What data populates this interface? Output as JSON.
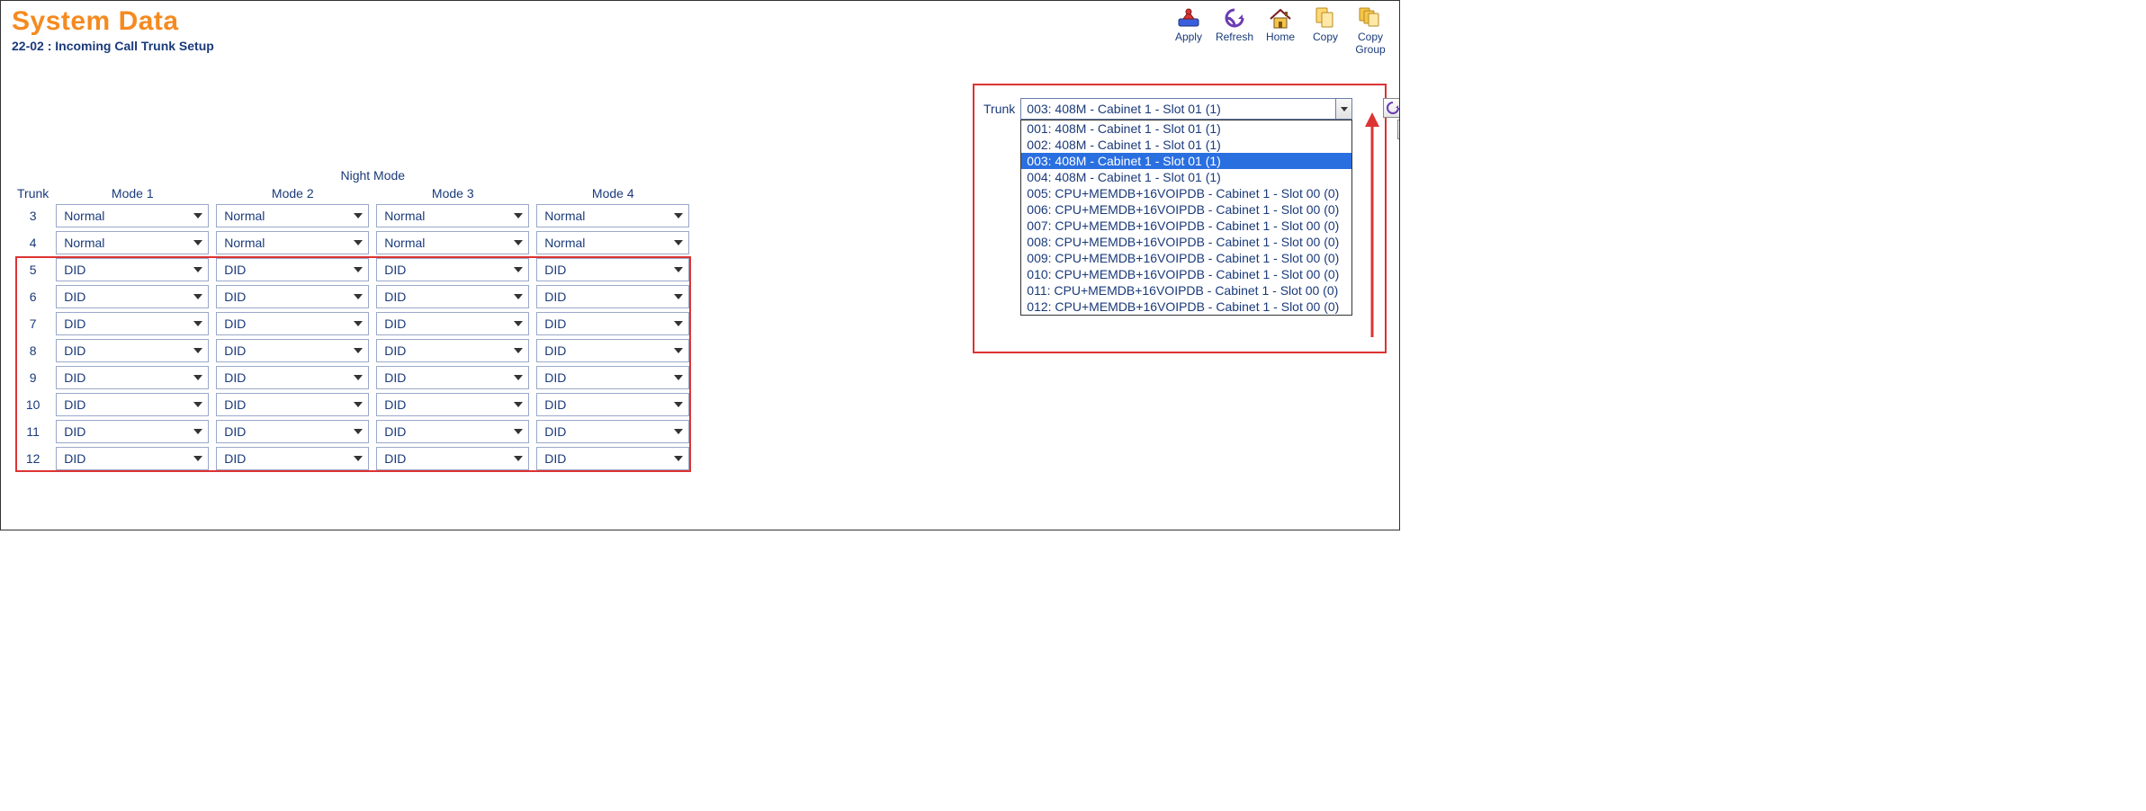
{
  "heading": {
    "title": "System Data",
    "subtitle": "22-02 : Incoming Call Trunk Setup"
  },
  "toolbar": {
    "apply": "Apply",
    "refresh": "Refresh",
    "home": "Home",
    "copy": "Copy",
    "copy_group": "Copy\nGroup"
  },
  "table": {
    "group_header": "Night Mode",
    "cols": [
      "Trunk",
      "Mode 1",
      "Mode 2",
      "Mode 3",
      "Mode 4"
    ],
    "rows": [
      {
        "trunk": "3",
        "modes": [
          "Normal",
          "Normal",
          "Normal",
          "Normal"
        ]
      },
      {
        "trunk": "4",
        "modes": [
          "Normal",
          "Normal",
          "Normal",
          "Normal"
        ]
      },
      {
        "trunk": "5",
        "modes": [
          "DID",
          "DID",
          "DID",
          "DID"
        ]
      },
      {
        "trunk": "6",
        "modes": [
          "DID",
          "DID",
          "DID",
          "DID"
        ]
      },
      {
        "trunk": "7",
        "modes": [
          "DID",
          "DID",
          "DID",
          "DID"
        ]
      },
      {
        "trunk": "8",
        "modes": [
          "DID",
          "DID",
          "DID",
          "DID"
        ]
      },
      {
        "trunk": "9",
        "modes": [
          "DID",
          "DID",
          "DID",
          "DID"
        ]
      },
      {
        "trunk": "10",
        "modes": [
          "DID",
          "DID",
          "DID",
          "DID"
        ]
      },
      {
        "trunk": "11",
        "modes": [
          "DID",
          "DID",
          "DID",
          "DID"
        ]
      },
      {
        "trunk": "12",
        "modes": [
          "DID",
          "DID",
          "DID",
          "DID"
        ]
      }
    ],
    "highlight_from_row_index": 2
  },
  "trunk_selector": {
    "label": "Trunk",
    "selected": "003: 408M - Cabinet 1 - Slot 01 (1)",
    "selected_index": 2,
    "options": [
      "001: 408M - Cabinet 1 - Slot 01 (1)",
      "002: 408M - Cabinet 1 - Slot 01 (1)",
      "003: 408M - Cabinet 1 - Slot 01 (1)",
      "004: 408M - Cabinet 1 - Slot 01 (1)",
      "005: CPU+MEMDB+16VOIPDB - Cabinet 1 - Slot 00 (0)",
      "006: CPU+MEMDB+16VOIPDB - Cabinet 1 - Slot 00 (0)",
      "007: CPU+MEMDB+16VOIPDB - Cabinet 1 - Slot 00 (0)",
      "008: CPU+MEMDB+16VOIPDB - Cabinet 1 - Slot 00 (0)",
      "009: CPU+MEMDB+16VOIPDB - Cabinet 1 - Slot 00 (0)",
      "010: CPU+MEMDB+16VOIPDB - Cabinet 1 - Slot 00 (0)",
      "011: CPU+MEMDB+16VOIPDB - Cabinet 1 - Slot 00 (0)",
      "012: CPU+MEMDB+16VOIPDB - Cabinet 1 - Slot 00 (0)"
    ]
  }
}
